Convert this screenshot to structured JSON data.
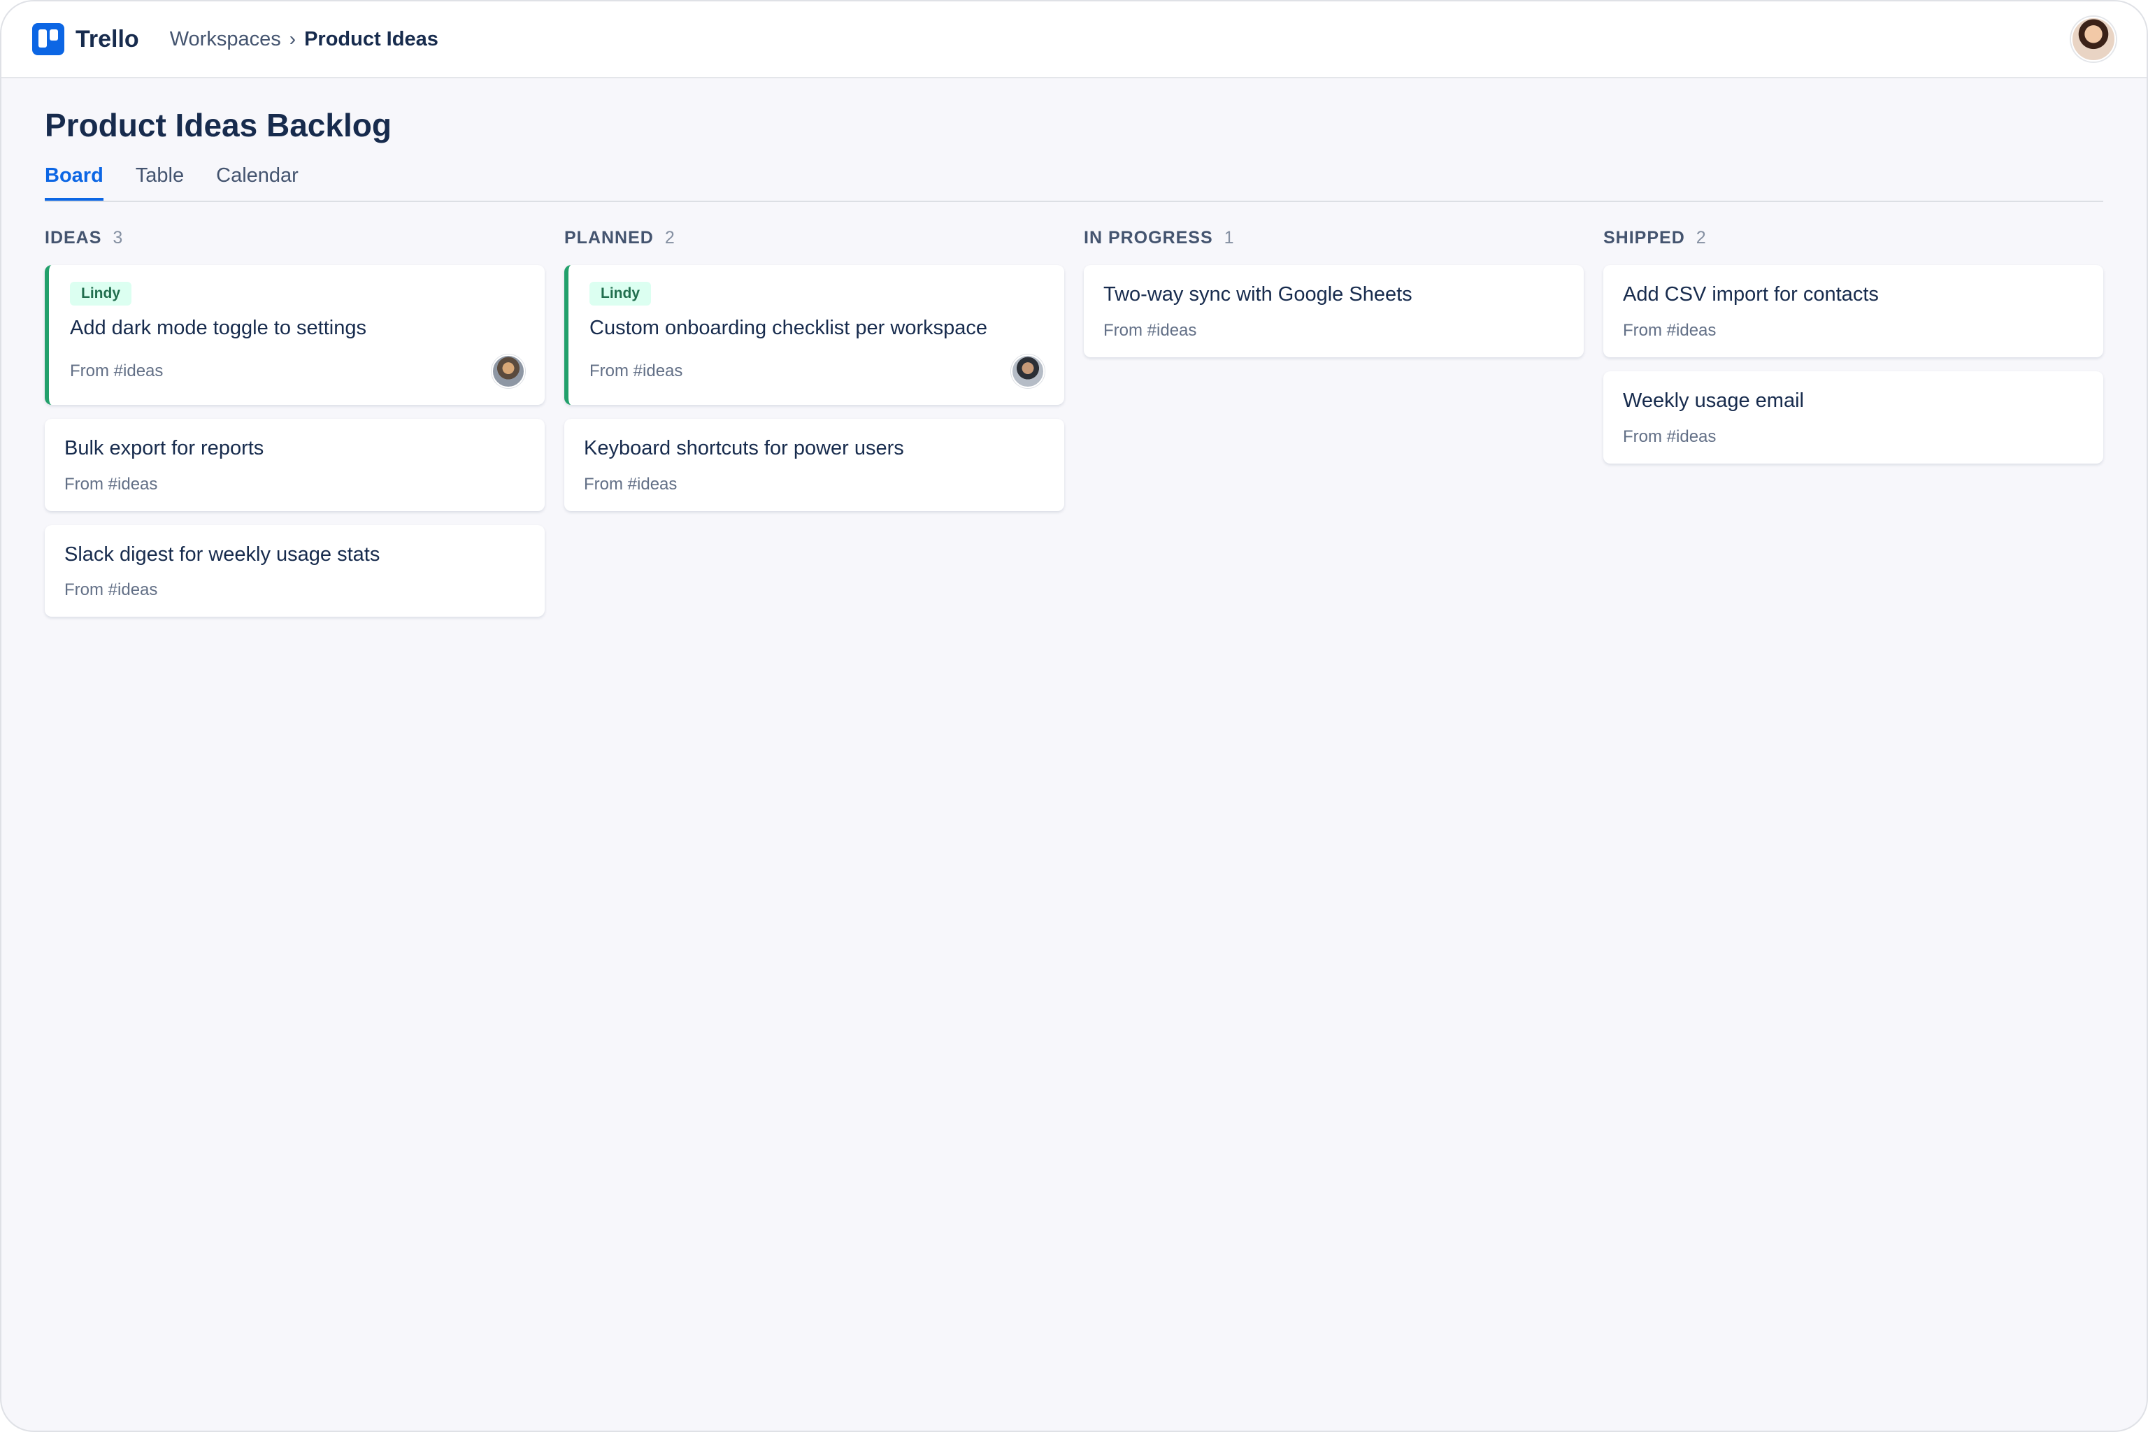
{
  "app": {
    "name": "Trello",
    "logo_icon": "trello-logo-icon",
    "accent_color": "#0c66e4"
  },
  "breadcrumb": {
    "parent": "Workspaces",
    "separator": "›",
    "current": "Product Ideas"
  },
  "user": {
    "avatar_icon": "user-avatar"
  },
  "page": {
    "title": "Product Ideas Backlog"
  },
  "tabs": [
    {
      "label": "Board",
      "active": true
    },
    {
      "label": "Table",
      "active": false
    },
    {
      "label": "Calendar",
      "active": false
    }
  ],
  "columns": [
    {
      "name": "IDEAS",
      "count": "3",
      "cards": [
        {
          "label": "Lindy",
          "title": "Add dark mode toggle to settings",
          "source": "From #ideas",
          "has_avatar": true
        },
        {
          "title": "Bulk export for reports",
          "source": "From #ideas"
        },
        {
          "title": "Slack digest for weekly usage stats",
          "source": "From #ideas"
        }
      ]
    },
    {
      "name": "PLANNED",
      "count": "2",
      "cards": [
        {
          "label": "Lindy",
          "title": "Custom onboarding checklist per workspace",
          "source": "From #ideas",
          "has_avatar": true
        },
        {
          "title": "Keyboard shortcuts for power users",
          "source": "From #ideas"
        }
      ]
    },
    {
      "name": "IN PROGRESS",
      "count": "1",
      "cards": [
        {
          "title": "Two-way sync with Google Sheets",
          "source": "From #ideas"
        }
      ]
    },
    {
      "name": "SHIPPED",
      "count": "2",
      "cards": [
        {
          "title": "Add CSV import for contacts",
          "source": "From #ideas"
        },
        {
          "title": "Weekly usage email",
          "source": "From #ideas"
        }
      ]
    }
  ],
  "colors": {
    "label_bg": "#dcfff1",
    "label_text": "#216e4e",
    "flag_border": "#22a06b"
  }
}
